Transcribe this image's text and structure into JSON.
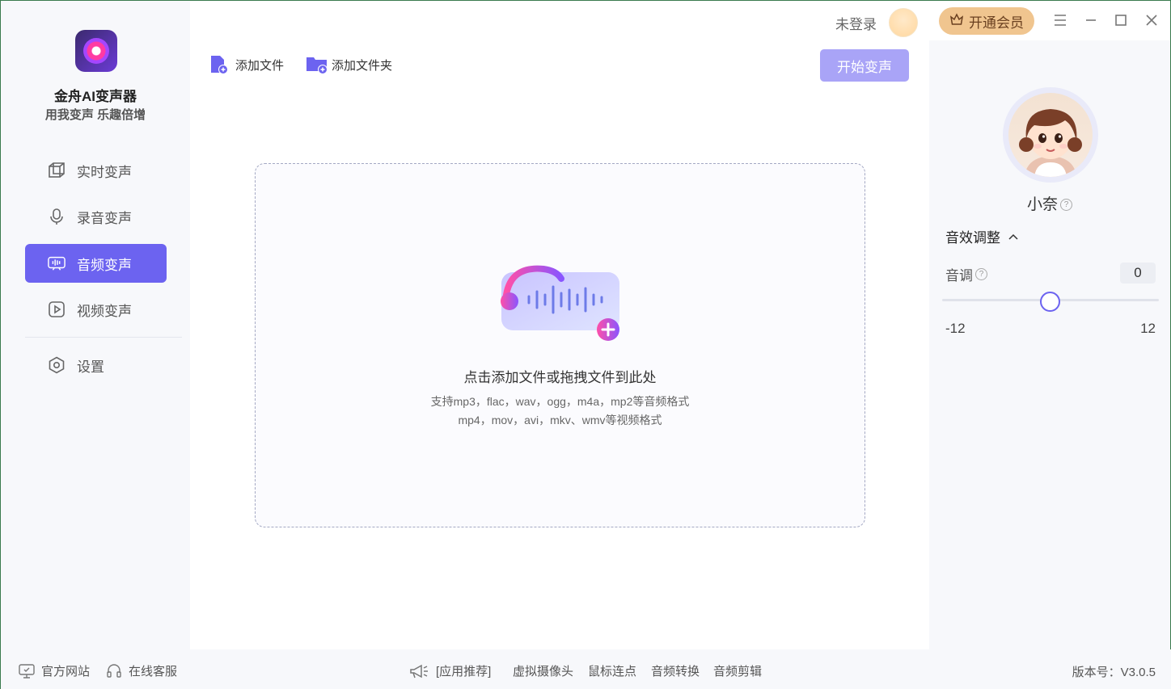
{
  "app": {
    "name": "金舟AI变声器",
    "slogan": "用我变声 乐趣倍增"
  },
  "sidebar": {
    "items": [
      {
        "label": "实时变声",
        "icon": "cube-icon"
      },
      {
        "label": "录音变声",
        "icon": "microphone-icon"
      },
      {
        "label": "音频变声",
        "icon": "audio-wave-icon",
        "active": true
      },
      {
        "label": "视频变声",
        "icon": "play-icon"
      },
      {
        "label": "设置",
        "icon": "gear-icon"
      }
    ]
  },
  "toolbar": {
    "add_file": "添加文件",
    "add_folder": "添加文件夹",
    "start": "开始变声"
  },
  "dropzone": {
    "title": "点击添加文件或拖拽文件到此处",
    "audio_formats": "支持mp3，flac，wav，ogg，m4a，mp2等音频格式",
    "video_formats": "mp4，mov，avi，mkv、wmv等视频格式"
  },
  "titlebar": {
    "login": "未登录",
    "vip": "开通会员"
  },
  "right_panel": {
    "voice_name": "小奈",
    "effect_title": "音效调整",
    "pitch_label": "音调",
    "pitch_value": "0",
    "slider_min": "-12",
    "slider_max": "12"
  },
  "bottombar": {
    "website": "官方网站",
    "support": "在线客服",
    "recommend": "[应用推荐]",
    "virtual_camera": "虚拟摄像头",
    "mouse_clicker": "鼠标连点",
    "audio_convert": "音频转换",
    "audio_edit": "音频剪辑",
    "version": "版本号：V3.0.5"
  },
  "colors": {
    "accent": "#6c63f0",
    "start_button": "#a9a4f7",
    "vip": "#f0c58f"
  }
}
